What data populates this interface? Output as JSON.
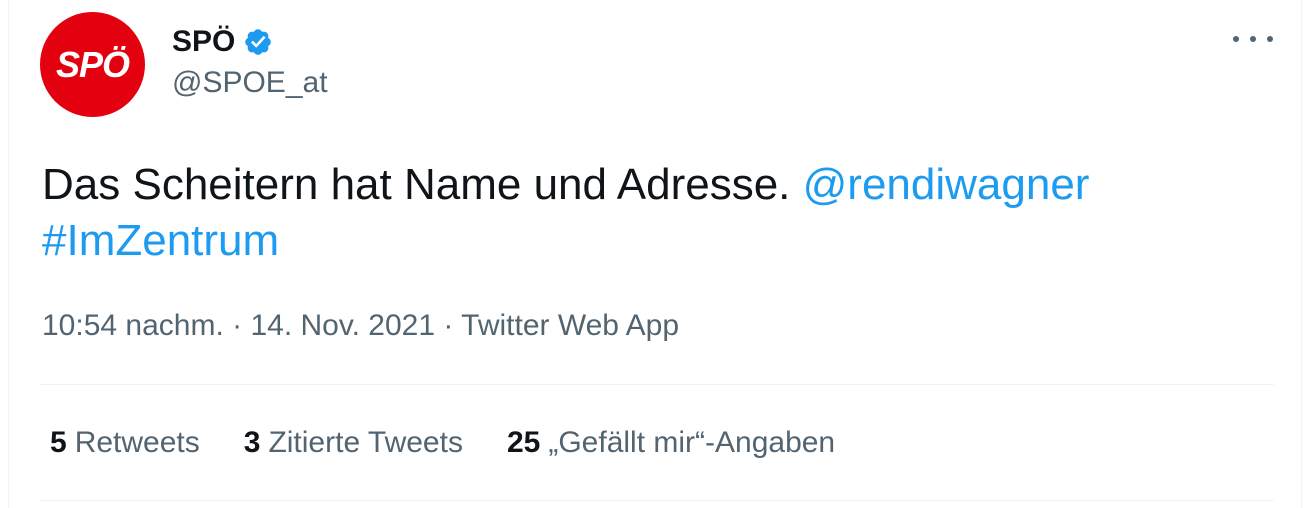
{
  "author": {
    "avatar_text": "SPÖ",
    "display_name": "SPÖ",
    "handle": "@SPOE_at",
    "verified_icon": "verified-badge-icon",
    "brand_color": "#e3000f"
  },
  "tweet": {
    "text": "Das Scheitern hat Name und Adresse. ",
    "mention": "@rendiwagner",
    "hashtag": "#ImZentrum",
    "link_color": "#1d9bf0"
  },
  "meta": {
    "time": "10:54 nachm.",
    "sep1": " · ",
    "date": "14. Nov. 2021",
    "sep2": " · ",
    "source": "Twitter Web App"
  },
  "stats": {
    "retweets_count": "5",
    "retweets_label": "Retweets",
    "quotes_count": "3",
    "quotes_label": "Zitierte Tweets",
    "likes_count": "25",
    "likes_label": "„Gefällt mir“-Angaben"
  },
  "menu": {
    "more_icon": "more-options-icon"
  }
}
